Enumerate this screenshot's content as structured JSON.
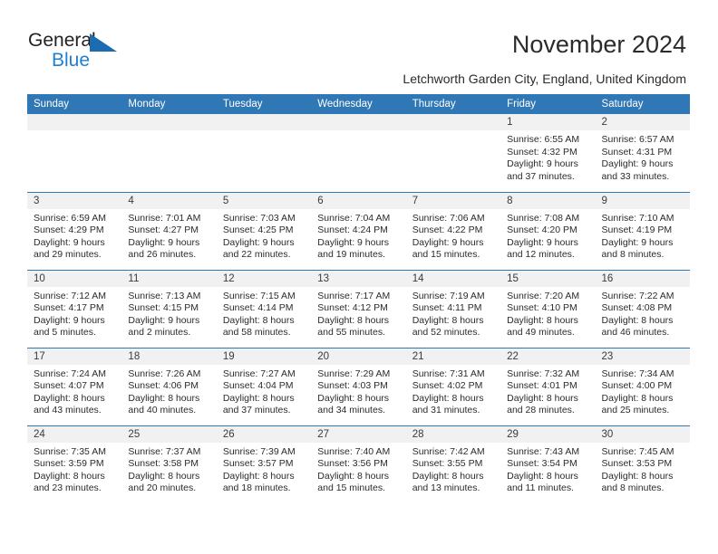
{
  "brand": {
    "name_top": "General",
    "name_bottom": "Blue",
    "triangle_color": "#1b6cb0",
    "bottom_color": "#1f7fd0"
  },
  "header": {
    "title": "November 2024",
    "subtitle": "Letchworth Garden City, England, United Kingdom"
  },
  "theme": {
    "header_bg": "#3077b5",
    "header_text": "#ffffff",
    "daynum_band_bg": "#f1f1f1",
    "row_border": "#3077b5",
    "body_text": "#2b2b2b"
  },
  "calendar": {
    "weekday_headers": [
      "Sunday",
      "Monday",
      "Tuesday",
      "Wednesday",
      "Thursday",
      "Friday",
      "Saturday"
    ],
    "weeks": [
      [
        {
          "day": "",
          "lines": []
        },
        {
          "day": "",
          "lines": []
        },
        {
          "day": "",
          "lines": []
        },
        {
          "day": "",
          "lines": []
        },
        {
          "day": "",
          "lines": []
        },
        {
          "day": "1",
          "lines": [
            "Sunrise: 6:55 AM",
            "Sunset: 4:32 PM",
            "Daylight: 9 hours",
            "and 37 minutes."
          ]
        },
        {
          "day": "2",
          "lines": [
            "Sunrise: 6:57 AM",
            "Sunset: 4:31 PM",
            "Daylight: 9 hours",
            "and 33 minutes."
          ]
        }
      ],
      [
        {
          "day": "3",
          "lines": [
            "Sunrise: 6:59 AM",
            "Sunset: 4:29 PM",
            "Daylight: 9 hours",
            "and 29 minutes."
          ]
        },
        {
          "day": "4",
          "lines": [
            "Sunrise: 7:01 AM",
            "Sunset: 4:27 PM",
            "Daylight: 9 hours",
            "and 26 minutes."
          ]
        },
        {
          "day": "5",
          "lines": [
            "Sunrise: 7:03 AM",
            "Sunset: 4:25 PM",
            "Daylight: 9 hours",
            "and 22 minutes."
          ]
        },
        {
          "day": "6",
          "lines": [
            "Sunrise: 7:04 AM",
            "Sunset: 4:24 PM",
            "Daylight: 9 hours",
            "and 19 minutes."
          ]
        },
        {
          "day": "7",
          "lines": [
            "Sunrise: 7:06 AM",
            "Sunset: 4:22 PM",
            "Daylight: 9 hours",
            "and 15 minutes."
          ]
        },
        {
          "day": "8",
          "lines": [
            "Sunrise: 7:08 AM",
            "Sunset: 4:20 PM",
            "Daylight: 9 hours",
            "and 12 minutes."
          ]
        },
        {
          "day": "9",
          "lines": [
            "Sunrise: 7:10 AM",
            "Sunset: 4:19 PM",
            "Daylight: 9 hours",
            "and 8 minutes."
          ]
        }
      ],
      [
        {
          "day": "10",
          "lines": [
            "Sunrise: 7:12 AM",
            "Sunset: 4:17 PM",
            "Daylight: 9 hours",
            "and 5 minutes."
          ]
        },
        {
          "day": "11",
          "lines": [
            "Sunrise: 7:13 AM",
            "Sunset: 4:15 PM",
            "Daylight: 9 hours",
            "and 2 minutes."
          ]
        },
        {
          "day": "12",
          "lines": [
            "Sunrise: 7:15 AM",
            "Sunset: 4:14 PM",
            "Daylight: 8 hours",
            "and 58 minutes."
          ]
        },
        {
          "day": "13",
          "lines": [
            "Sunrise: 7:17 AM",
            "Sunset: 4:12 PM",
            "Daylight: 8 hours",
            "and 55 minutes."
          ]
        },
        {
          "day": "14",
          "lines": [
            "Sunrise: 7:19 AM",
            "Sunset: 4:11 PM",
            "Daylight: 8 hours",
            "and 52 minutes."
          ]
        },
        {
          "day": "15",
          "lines": [
            "Sunrise: 7:20 AM",
            "Sunset: 4:10 PM",
            "Daylight: 8 hours",
            "and 49 minutes."
          ]
        },
        {
          "day": "16",
          "lines": [
            "Sunrise: 7:22 AM",
            "Sunset: 4:08 PM",
            "Daylight: 8 hours",
            "and 46 minutes."
          ]
        }
      ],
      [
        {
          "day": "17",
          "lines": [
            "Sunrise: 7:24 AM",
            "Sunset: 4:07 PM",
            "Daylight: 8 hours",
            "and 43 minutes."
          ]
        },
        {
          "day": "18",
          "lines": [
            "Sunrise: 7:26 AM",
            "Sunset: 4:06 PM",
            "Daylight: 8 hours",
            "and 40 minutes."
          ]
        },
        {
          "day": "19",
          "lines": [
            "Sunrise: 7:27 AM",
            "Sunset: 4:04 PM",
            "Daylight: 8 hours",
            "and 37 minutes."
          ]
        },
        {
          "day": "20",
          "lines": [
            "Sunrise: 7:29 AM",
            "Sunset: 4:03 PM",
            "Daylight: 8 hours",
            "and 34 minutes."
          ]
        },
        {
          "day": "21",
          "lines": [
            "Sunrise: 7:31 AM",
            "Sunset: 4:02 PM",
            "Daylight: 8 hours",
            "and 31 minutes."
          ]
        },
        {
          "day": "22",
          "lines": [
            "Sunrise: 7:32 AM",
            "Sunset: 4:01 PM",
            "Daylight: 8 hours",
            "and 28 minutes."
          ]
        },
        {
          "day": "23",
          "lines": [
            "Sunrise: 7:34 AM",
            "Sunset: 4:00 PM",
            "Daylight: 8 hours",
            "and 25 minutes."
          ]
        }
      ],
      [
        {
          "day": "24",
          "lines": [
            "Sunrise: 7:35 AM",
            "Sunset: 3:59 PM",
            "Daylight: 8 hours",
            "and 23 minutes."
          ]
        },
        {
          "day": "25",
          "lines": [
            "Sunrise: 7:37 AM",
            "Sunset: 3:58 PM",
            "Daylight: 8 hours",
            "and 20 minutes."
          ]
        },
        {
          "day": "26",
          "lines": [
            "Sunrise: 7:39 AM",
            "Sunset: 3:57 PM",
            "Daylight: 8 hours",
            "and 18 minutes."
          ]
        },
        {
          "day": "27",
          "lines": [
            "Sunrise: 7:40 AM",
            "Sunset: 3:56 PM",
            "Daylight: 8 hours",
            "and 15 minutes."
          ]
        },
        {
          "day": "28",
          "lines": [
            "Sunrise: 7:42 AM",
            "Sunset: 3:55 PM",
            "Daylight: 8 hours",
            "and 13 minutes."
          ]
        },
        {
          "day": "29",
          "lines": [
            "Sunrise: 7:43 AM",
            "Sunset: 3:54 PM",
            "Daylight: 8 hours",
            "and 11 minutes."
          ]
        },
        {
          "day": "30",
          "lines": [
            "Sunrise: 7:45 AM",
            "Sunset: 3:53 PM",
            "Daylight: 8 hours",
            "and 8 minutes."
          ]
        }
      ]
    ]
  }
}
